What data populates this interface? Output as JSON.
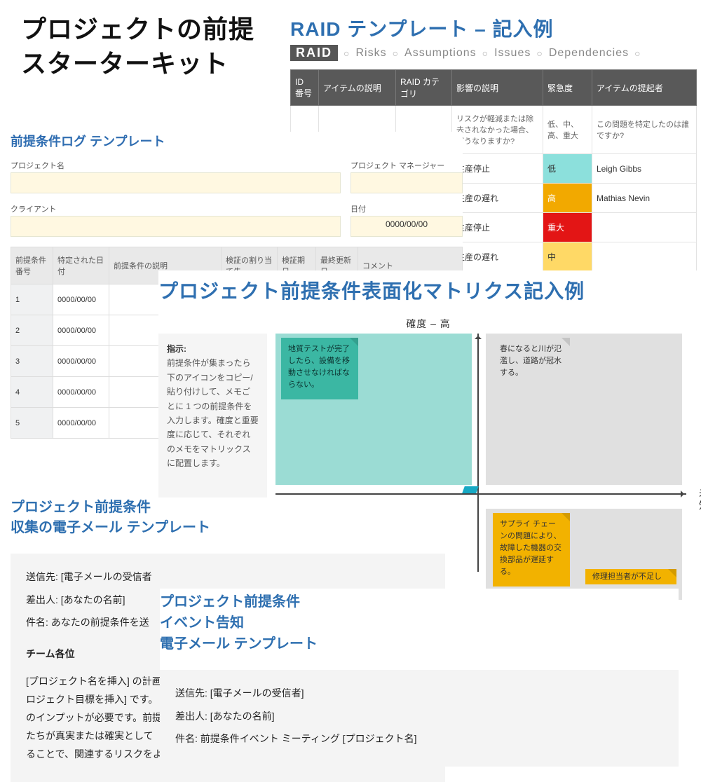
{
  "main_title_l1": "プロジェクトの前提",
  "main_title_l2": "スターターキット",
  "raid": {
    "title": "RAID テンプレート – 記入例",
    "badge": "RAID",
    "sub": [
      "Risks",
      "Assumptions",
      "Issues",
      "Dependencies"
    ],
    "headers": [
      "ID 番号",
      "アイテムの説明",
      "RAID カテゴリ",
      "影響の説明",
      "緊急度",
      "アイテムの提起者"
    ],
    "explain": {
      "impact": "リスクが軽減または除去されなかった場合、どうなりますか?",
      "urgency": "低、中、高、重大",
      "raiser": "この問題を特定したのは誰ですか?"
    },
    "rows": [
      {
        "impact": "生産停止",
        "urgency": "低",
        "urg_cls": "urg-low",
        "raiser": "Leigh Gibbs"
      },
      {
        "impact": "生産の遅れ",
        "urgency": "高",
        "urg_cls": "urg-high",
        "raiser": "Mathias Nevin"
      },
      {
        "impact": "生産停止",
        "urgency": "重大",
        "urg_cls": "urg-crit",
        "raiser": ""
      },
      {
        "impact": "生産の遅れ",
        "urgency": "中",
        "urg_cls": "urg-mid",
        "raiser": ""
      }
    ]
  },
  "alog": {
    "title": "前提条件ログ テンプレート",
    "labels": {
      "project": "プロジェクト名",
      "manager": "プロジェクト マネージャー",
      "client": "クライアント",
      "date": "日付"
    },
    "date_value": "0000/00/00",
    "headers": [
      "前提条件番号",
      "特定された日付",
      "前提条件の説明",
      "検証の割り当て先",
      "検証期日",
      "最終更新日",
      "コメント"
    ],
    "rows": [
      {
        "n": "1",
        "d": "0000/00/00"
      },
      {
        "n": "2",
        "d": "0000/00/00"
      },
      {
        "n": "3",
        "d": "0000/00/00"
      },
      {
        "n": "4",
        "d": "0000/00/00"
      },
      {
        "n": "5",
        "d": "0000/00/00"
      }
    ]
  },
  "matrix": {
    "title": "プロジェクト前提条件表面化マトリクス記入例",
    "axis_top": "確度 – 高",
    "axis_right": "未知",
    "instr_label": "指示:",
    "instr_body": "前提条件が集まったら下のアイコンをコピー/貼り付けして、メモごとに 1 つの前提条件を入力します。確度と重要度に応じて、それぞれのメモをマトリックスに配置します。",
    "notes": {
      "teal": "地質テストが完了したら、設備を移動させなければならない。",
      "grey": "春になると川が氾濫し、道路が冠水する。",
      "amber": "サプライ チェーンの問題により、故障した機器の交換部品が遅延する。",
      "amber2": "修理担当者が不足し"
    }
  },
  "email1": {
    "title_l1": "プロジェクト前提条件",
    "title_l2": "収集の電子メール テンプレート",
    "to_label": "送信先:",
    "to_val": "[電子メールの受信者",
    "from_label": "差出人:",
    "from_val": "[あなたの名前]",
    "subj_label": "件名:",
    "subj_val": "あなたの前提条件を送",
    "team_header": "チーム各位",
    "body": "[プロジェクト名を挿入] の計画\nロジェクト目標を挿入] です。\nのインプットが必要です。前提\nたちが真実または確実として\nることで、関連するリスクをよ"
  },
  "email2": {
    "title_l1": "プロジェクト前提条件",
    "title_l2": "イベント告知",
    "title_l3": "電子メール テンプレート",
    "to_label": "送信先:",
    "to_val": "[電子メールの受信者]",
    "from_label": "差出人:",
    "from_val": "[あなたの名前]",
    "subj_label": "件名:",
    "subj_val": "前提条件イベント ミーティング [プロジェクト名]"
  }
}
